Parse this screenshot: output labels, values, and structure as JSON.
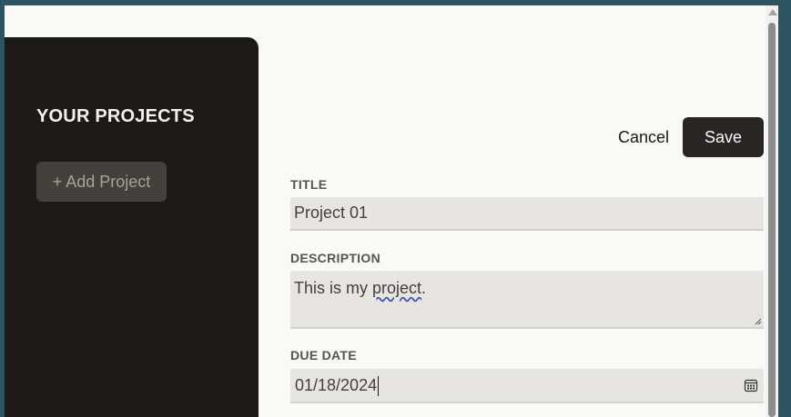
{
  "sidebar": {
    "title": "YOUR PROJECTS",
    "add_button_label": "+ Add Project"
  },
  "form": {
    "cancel_label": "Cancel",
    "save_label": "Save",
    "title_label": "TITLE",
    "title_value": "Project 01",
    "description_label": "DESCRIPTION",
    "description_value_before": "This is my ",
    "description_value_misspelled": "project",
    "description_value_after": ".",
    "due_date_label": "DUE DATE",
    "due_date_value": "01/18/2024"
  },
  "colors": {
    "sidebar_bg": "#1c1917",
    "save_bg": "#292524",
    "field_bg": "#e7e5e2",
    "page_bg": "#f9f9f7"
  },
  "icons": [
    "calendar-icon",
    "resize-grip-icon",
    "scroll-up-arrow-icon"
  ]
}
